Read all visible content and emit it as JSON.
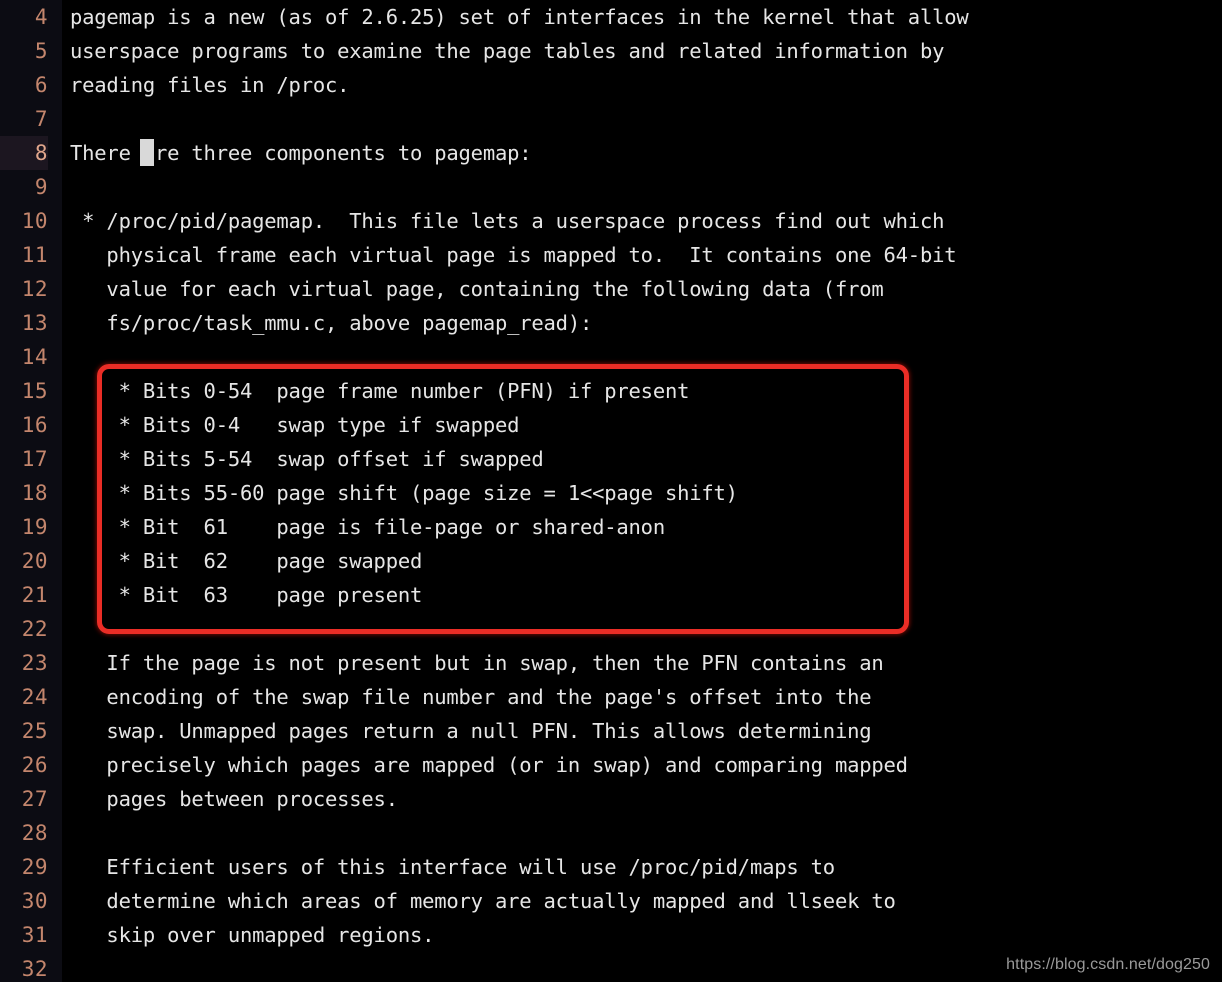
{
  "editor": {
    "background_color": "#000000",
    "gutter_color": "#0c0c13",
    "line_number_color": "#c4866d",
    "text_color": "#e6e6e6",
    "current_line": 8,
    "lines": [
      {
        "number": "4",
        "text": "pagemap is a new (as of 2.6.25) set of interfaces in the kernel that allow"
      },
      {
        "number": "5",
        "text": "userspace programs to examine the page tables and related information by"
      },
      {
        "number": "6",
        "text": "reading files in /proc."
      },
      {
        "number": "7",
        "text": ""
      },
      {
        "number": "8",
        "text": "There are three components to pagemap:"
      },
      {
        "number": "9",
        "text": ""
      },
      {
        "number": "10",
        "text": " * /proc/pid/pagemap.  This file lets a userspace process find out which"
      },
      {
        "number": "11",
        "text": "   physical frame each virtual page is mapped to.  It contains one 64-bit"
      },
      {
        "number": "12",
        "text": "   value for each virtual page, containing the following data (from"
      },
      {
        "number": "13",
        "text": "   fs/proc/task_mmu.c, above pagemap_read):"
      },
      {
        "number": "14",
        "text": ""
      },
      {
        "number": "15",
        "text": "    * Bits 0-54  page frame number (PFN) if present"
      },
      {
        "number": "16",
        "text": "    * Bits 0-4   swap type if swapped"
      },
      {
        "number": "17",
        "text": "    * Bits 5-54  swap offset if swapped"
      },
      {
        "number": "18",
        "text": "    * Bits 55-60 page shift (page size = 1<<page shift)"
      },
      {
        "number": "19",
        "text": "    * Bit  61    page is file-page or shared-anon"
      },
      {
        "number": "20",
        "text": "    * Bit  62    page swapped"
      },
      {
        "number": "21",
        "text": "    * Bit  63    page present"
      },
      {
        "number": "22",
        "text": ""
      },
      {
        "number": "23",
        "text": "   If the page is not present but in swap, then the PFN contains an"
      },
      {
        "number": "24",
        "text": "   encoding of the swap file number and the page's offset into the"
      },
      {
        "number": "25",
        "text": "   swap. Unmapped pages return a null PFN. This allows determining"
      },
      {
        "number": "26",
        "text": "   precisely which pages are mapped (or in swap) and comparing mapped"
      },
      {
        "number": "27",
        "text": "   pages between processes."
      },
      {
        "number": "28",
        "text": ""
      },
      {
        "number": "29",
        "text": "   Efficient users of this interface will use /proc/pid/maps to"
      },
      {
        "number": "30",
        "text": "   determine which areas of memory are actually mapped and llseek to"
      },
      {
        "number": "31",
        "text": "   skip over unmapped regions."
      },
      {
        "number": "32",
        "text": ""
      }
    ]
  },
  "annotation": {
    "type": "rounded-rectangle-highlight",
    "color": "#ea2d26",
    "covers_lines": "15-21"
  },
  "watermark": {
    "text": "https://blog.csdn.net/dog250",
    "color": "#9a9a9a"
  }
}
